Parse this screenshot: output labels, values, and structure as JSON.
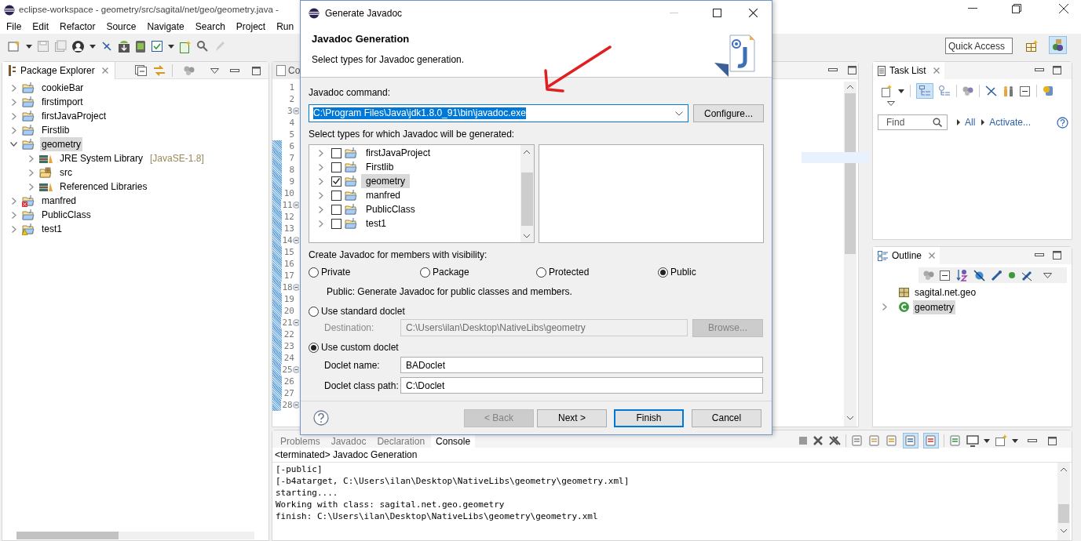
{
  "window": {
    "title": "eclipse-workspace - geometry/src/sagital/net/geo/geometry.java -"
  },
  "menu": [
    "File",
    "Edit",
    "Refactor",
    "Source",
    "Navigate",
    "Search",
    "Project",
    "Run"
  ],
  "quick_access": {
    "placeholder": "Quick Access"
  },
  "package_explorer": {
    "title": "Package Explorer",
    "items": [
      {
        "label": "cookieBar",
        "kind": "project",
        "expanded": false,
        "selected": false
      },
      {
        "label": "firstimport",
        "kind": "project",
        "expanded": false,
        "selected": false
      },
      {
        "label": "firstJavaProject",
        "kind": "project",
        "expanded": false,
        "selected": false
      },
      {
        "label": "Firstlib",
        "kind": "project",
        "expanded": false,
        "selected": false
      },
      {
        "label": "geometry",
        "kind": "project",
        "expanded": true,
        "selected": true,
        "children": [
          {
            "label": "JRE System Library",
            "suffix": "[JavaSE-1.8]",
            "kind": "library",
            "expanded": false,
            "selected": false
          },
          {
            "label": "src",
            "kind": "source",
            "expanded": false,
            "selected": false
          },
          {
            "label": "Referenced Libraries",
            "kind": "library",
            "expanded": false,
            "selected": false
          }
        ]
      },
      {
        "label": "manfred",
        "kind": "error_project",
        "expanded": false,
        "selected": false
      },
      {
        "label": "PublicClass",
        "kind": "project",
        "expanded": false,
        "selected": false
      },
      {
        "label": "test1",
        "kind": "warning_project",
        "expanded": false,
        "selected": false
      }
    ]
  },
  "editor": {
    "tab": "Co",
    "lines": [
      {
        "number": "1",
        "fold": false,
        "changed": false
      },
      {
        "number": "2",
        "fold": false,
        "changed": false
      },
      {
        "number": "3",
        "fold": true,
        "changed": false
      },
      {
        "number": "4",
        "fold": false,
        "changed": false
      },
      {
        "number": "5",
        "fold": false,
        "changed": false
      },
      {
        "number": "6",
        "fold": false,
        "changed": true
      },
      {
        "number": "7",
        "fold": false,
        "changed": true
      },
      {
        "number": "8",
        "fold": false,
        "changed": true
      },
      {
        "number": "9",
        "fold": false,
        "changed": true
      },
      {
        "number": "10",
        "fold": false,
        "changed": true
      },
      {
        "number": "11",
        "fold": true,
        "changed": true
      },
      {
        "number": "12",
        "fold": false,
        "changed": true
      },
      {
        "number": "13",
        "fold": false,
        "changed": true
      },
      {
        "number": "14",
        "fold": true,
        "changed": true
      },
      {
        "number": "15",
        "fold": false,
        "changed": true
      },
      {
        "number": "16",
        "fold": false,
        "changed": true
      },
      {
        "number": "17",
        "fold": false,
        "changed": true
      },
      {
        "number": "18",
        "fold": true,
        "changed": true
      },
      {
        "number": "19",
        "fold": false,
        "changed": true
      },
      {
        "number": "20",
        "fold": false,
        "changed": true
      },
      {
        "number": "21",
        "fold": true,
        "changed": true
      },
      {
        "number": "22",
        "fold": false,
        "changed": true
      },
      {
        "number": "23",
        "fold": false,
        "changed": true
      },
      {
        "number": "24",
        "fold": false,
        "changed": true
      },
      {
        "number": "25",
        "fold": true,
        "changed": true
      },
      {
        "number": "26",
        "fold": false,
        "changed": true
      },
      {
        "number": "27",
        "fold": false,
        "changed": true
      },
      {
        "number": "28",
        "fold": true,
        "changed": true
      }
    ]
  },
  "task_list": {
    "title": "Task List",
    "find": {
      "placeholder": "Find"
    },
    "links": [
      "All",
      "Activate..."
    ]
  },
  "outline": {
    "title": "Outline",
    "items": [
      {
        "label": "sagital.net.geo",
        "kind": "package",
        "expandable": false,
        "selected": false
      },
      {
        "label": "geometry",
        "kind": "class",
        "expandable": true,
        "selected": true
      }
    ]
  },
  "console": {
    "tabs": [
      {
        "label": "Problems",
        "selected": false
      },
      {
        "label": "Javadoc",
        "selected": false
      },
      {
        "label": "Declaration",
        "selected": false
      },
      {
        "label": "Console",
        "selected": true
      }
    ],
    "header": "<terminated> Javadoc Generation",
    "lines": [
      "[-public]",
      "[-b4atarget, C:\\Users\\ilan\\Desktop\\NativeLibs\\geometry\\geometry.xml]",
      "starting....",
      "Working with class: sagital.net.geo.geometry",
      "finish: C:\\Users\\ilan\\Desktop\\NativeLibs\\geometry\\geometry.xml"
    ]
  },
  "dialog": {
    "title": "Generate Javadoc",
    "heading": "Javadoc Generation",
    "subtitle": "Select types for Javadoc generation.",
    "command_label": "Javadoc command:",
    "command": "C:\\Program Files\\Java\\jdk1.8.0_91\\bin\\javadoc.exe",
    "configure": "Configure...",
    "types_label": "Select types for which Javadoc will be generated:",
    "types": [
      {
        "label": "firstJavaProject",
        "checked": false,
        "selected": false
      },
      {
        "label": "Firstlib",
        "checked": false,
        "selected": false
      },
      {
        "label": "geometry",
        "checked": true,
        "selected": true
      },
      {
        "label": "manfred",
        "checked": false,
        "selected": false
      },
      {
        "label": "PublicClass",
        "checked": false,
        "selected": false
      },
      {
        "label": "test1",
        "checked": false,
        "selected": false
      }
    ],
    "visibility_label": "Create Javadoc for members with visibility:",
    "visibility": [
      {
        "label": "Private",
        "selected": false
      },
      {
        "label": "Package",
        "selected": false
      },
      {
        "label": "Protected",
        "selected": false
      },
      {
        "label": "Public",
        "selected": true
      }
    ],
    "visibility_note": "Public: Generate Javadoc for public classes and members.",
    "standard_doclet": {
      "label": "Use standard doclet",
      "selected": false
    },
    "destination": {
      "label": "Destination:",
      "value": "C:\\Users\\ilan\\Desktop\\NativeLibs\\geometry",
      "disabled": true
    },
    "browse": {
      "label": "Browse...",
      "disabled": true
    },
    "custom_doclet": {
      "label": "Use custom doclet",
      "selected": true
    },
    "doclet_name": {
      "label": "Doclet name:",
      "value": "BADoclet"
    },
    "doclet_path": {
      "label": "Doclet class path:",
      "value": "C:\\Doclet"
    },
    "buttons": [
      {
        "label": "< Back",
        "disabled": true,
        "default": false
      },
      {
        "label": "Next >",
        "disabled": false,
        "default": false
      },
      {
        "label": "Finish",
        "disabled": false,
        "default": true
      },
      {
        "label": "Cancel",
        "disabled": false,
        "default": false
      }
    ]
  }
}
